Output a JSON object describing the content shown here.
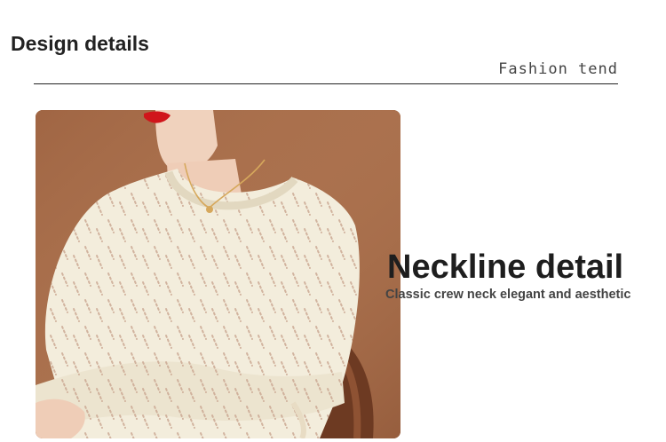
{
  "section": {
    "title": "Design details",
    "tagline": "Fashion tend"
  },
  "feature": {
    "headline": "Neckline detail",
    "subline": "Classic crew neck elegant and aesthetic"
  },
  "photo": {
    "subject": "product-photo-cream-knit-sweater",
    "colors": {
      "background": "#a86e4b",
      "sweater": "#f3eddc",
      "lips": "#d0151b",
      "necklace": "#d6a85c",
      "chair": "#6d3a22"
    }
  }
}
